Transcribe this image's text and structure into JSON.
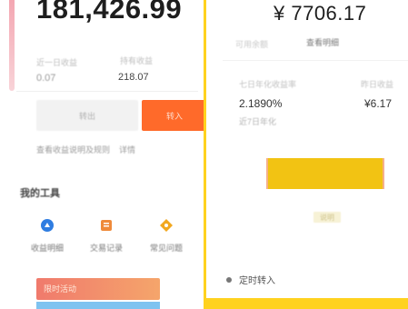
{
  "left_panel": {
    "total_amount": "181,426.99",
    "stat_labels": [
      "近一日收益",
      "持有收益"
    ],
    "stat_values": [
      "0.07",
      "218.07"
    ],
    "buttons": {
      "secondary": "转出",
      "primary": "转入"
    },
    "tip": {
      "text": "查看收益说明及规则",
      "link": "详情"
    },
    "section_title": "我的工具",
    "quick_actions": [
      {
        "label": "收益明细",
        "icon": "chart-icon",
        "color": "#2f7de1"
      },
      {
        "label": "交易记录",
        "icon": "list-icon",
        "color": "#ef8a3a"
      },
      {
        "label": "常见问题",
        "icon": "help-icon",
        "color": "#f2a81f"
      }
    ],
    "banner_text": "限时活动"
  },
  "right_panel": {
    "amount": "¥ 7706.17",
    "sub_left": "可用余额",
    "sub_right": "查看明细",
    "metric_labels": [
      "七日年化收益率",
      "昨日收益"
    ],
    "rate": "2.1890%",
    "daily": "¥6.17",
    "note": "近7日年化",
    "cta_label": "",
    "link_text": "说明",
    "check_label": "定时转入"
  },
  "colors": {
    "accent_orange": "#ff6a2a",
    "accent_yellow": "#ffd21f",
    "cta_yellow": "#f2c313"
  }
}
